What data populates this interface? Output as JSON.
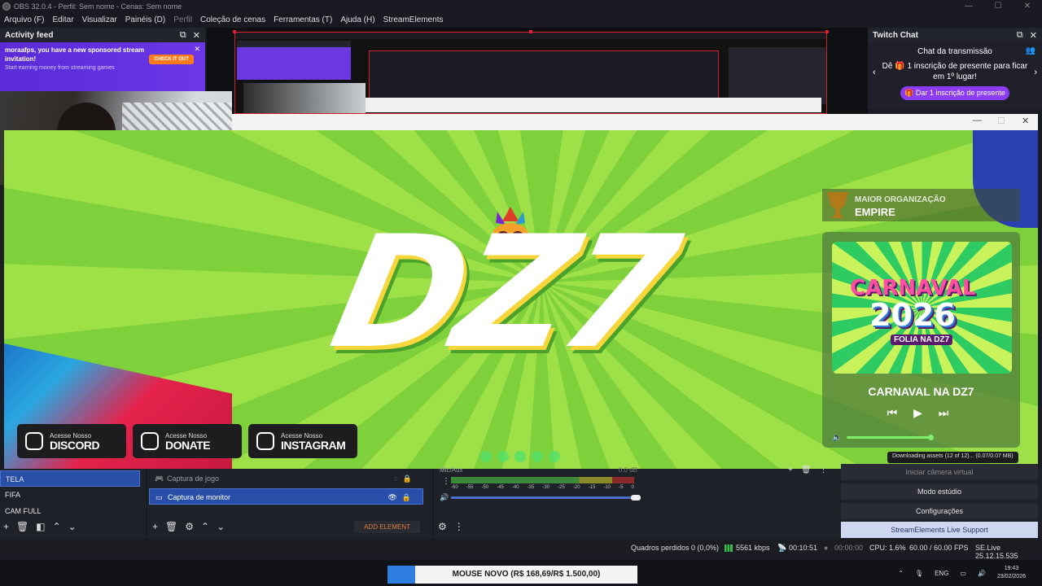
{
  "window": {
    "title": "OBS 32.0.4 - Perfil: Sem nome - Cenas: Sem nome"
  },
  "menu": [
    "Arquivo (F)",
    "Editar",
    "Visualizar",
    "Painéis (D)",
    "Perfil",
    "Coleção de cenas",
    "Ferramentas (T)",
    "Ajuda (H)",
    "StreamElements"
  ],
  "activity_feed": {
    "title": "Activity feed",
    "notification": "moraafps, you have a new sponsored stream invitation!",
    "subtext": "Start earning money from streaming games",
    "cta": "CHECK IT OUT"
  },
  "twitch_chat": {
    "title": "Twitch Chat",
    "header": "Chat da transmissão",
    "gift_text": "Dê 🎁 1 inscrição de presente para ficar em 1º lugar!",
    "gift_button": "🎁 Dar 1 inscrição de presente"
  },
  "stage": {
    "logo": "DZ7",
    "empire_label": "MAIOR ORGANIZAÇÃO",
    "empire_value": "EMPIRE",
    "art_line1": "CARNAVAL",
    "art_line2": "2026",
    "art_line3": "FOLIA NA DZ7",
    "track_name": "CARNAVAL NA DZ7",
    "player_controls": "⏮ ▶ ⏭",
    "downloading": "Downloading assets (12 of 12)... (0.07/0.07 MB)",
    "social": [
      {
        "small": "Acesse Nosso",
        "big": "DISCORD"
      },
      {
        "small": "Acesse Nosso",
        "big": "DONATE"
      },
      {
        "small": "Acesse Nosso",
        "big": "INSTAGRAM"
      }
    ]
  },
  "scenes": [
    "TELA",
    "FIFA",
    "CAM FULL"
  ],
  "sources": [
    {
      "name": "Captura de jogo",
      "active": false
    },
    {
      "name": "Captura de monitor",
      "active": true
    }
  ],
  "sources_add_button": "ADD ELEMENT",
  "mixer": {
    "label": "Mic/Aux",
    "db": "0.0 dB",
    "ticks": [
      "-60",
      "-55",
      "-50",
      "-45",
      "-40",
      "-35",
      "-30",
      "-25",
      "-20",
      "-15",
      "-10",
      "-5",
      "0"
    ]
  },
  "controls": {
    "virtual_cam": "Iniciar câmera virtual",
    "studio_mode": "Modo estúdio",
    "settings": "Configurações",
    "se_support": "StreamElements Live Support"
  },
  "status": {
    "dropped": "Quadros perdidos 0 (0,0%)",
    "bitrate": "5561 kbps",
    "live_time": "00:10:51",
    "rec_time": "00:00:00",
    "cpu": "CPU: 1.6%",
    "fps": "60.00 / 60.00 FPS",
    "se_version": "SE.Live 25.12.15.535"
  },
  "taskbar": {
    "window_title": "MOUSE NOVO (R$ 168,69/R$ 1.500,00)",
    "lang": "ENG",
    "time": "19:43",
    "date": "23/02/2026"
  },
  "colors": {
    "accent": "#284ea8",
    "twitch": "#8a3df5",
    "stage_green": "#8fd944"
  }
}
